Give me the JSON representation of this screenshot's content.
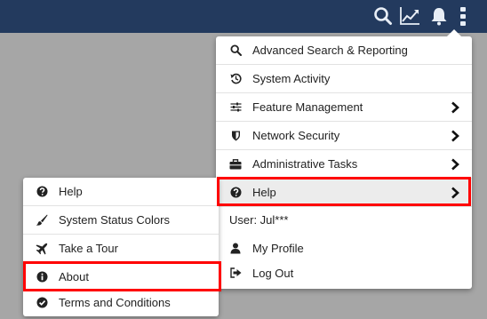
{
  "topbar": {
    "icons": [
      "search-icon",
      "chart-icon",
      "bell-icon",
      "more-vertical-icon"
    ],
    "color": "#233a5e"
  },
  "main_menu": {
    "items": [
      {
        "label": "Advanced Search & Reporting",
        "icon": "search-icon"
      },
      {
        "label": "System Activity",
        "icon": "history-icon"
      },
      {
        "label": "Feature Management",
        "icon": "sliders-icon",
        "has_submenu": true
      },
      {
        "label": "Network Security",
        "icon": "shield-icon",
        "has_submenu": true
      },
      {
        "label": "Administrative Tasks",
        "icon": "briefcase-icon",
        "has_submenu": true
      },
      {
        "label": "Help",
        "icon": "question-circle-icon",
        "has_submenu": true
      }
    ],
    "user_label": "User: Jul***",
    "account_items": [
      {
        "label": "My Profile",
        "icon": "user-icon"
      },
      {
        "label": "Log Out",
        "icon": "sign-out-icon"
      }
    ]
  },
  "help_submenu": {
    "items": [
      {
        "label": "Help",
        "icon": "question-circle-icon"
      },
      {
        "label": "System Status Colors",
        "icon": "paint-brush-icon"
      },
      {
        "label": "Take a Tour",
        "icon": "plane-icon"
      },
      {
        "label": "About",
        "icon": "info-circle-icon"
      },
      {
        "label": "Terms and Conditions",
        "icon": "check-circle-icon"
      }
    ]
  },
  "colors": {
    "highlight": "#ff0000",
    "backdrop": "#a6a6a6"
  }
}
